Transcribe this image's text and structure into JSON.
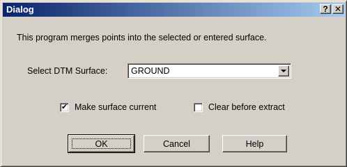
{
  "window": {
    "title": "Dialog",
    "help_button": "?",
    "close_button": "✕"
  },
  "description": "This program merges points into the selected or entered surface.",
  "surface": {
    "label": "Select DTM Surface:",
    "value": "GROUND"
  },
  "options": {
    "make_current": {
      "label": "Make surface current",
      "checked": true,
      "mark": "✔"
    },
    "clear_before": {
      "label": "Clear before extract",
      "checked": false,
      "mark": ""
    }
  },
  "buttons": {
    "ok": "OK",
    "cancel": "Cancel",
    "help": "Help"
  },
  "colors": {
    "titlebar_start": "#0a246a",
    "titlebar_end": "#a6caf0",
    "face": "#d4d0c8"
  }
}
